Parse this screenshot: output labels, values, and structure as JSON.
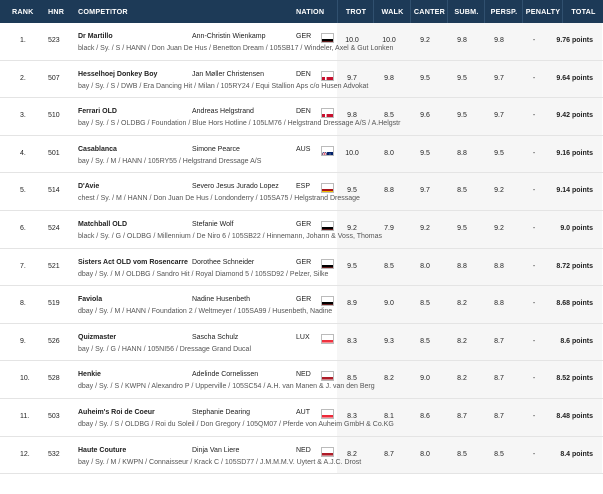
{
  "header": {
    "rank": "RANK",
    "hnr": "HNR",
    "competitor": "COMPETITOR",
    "nation": "NATION",
    "trot": "TROT",
    "walk": "WALK",
    "canter": "CANTER",
    "subm": "SUBM.",
    "persp": "PERSP.",
    "penalty": "PENALTY",
    "total": "TOTAL"
  },
  "rows": [
    {
      "rank": "1.",
      "hnr": "523",
      "horse": "Dr Martillo",
      "info": "black / Sy. / S / HANN / Don Juan De Hus / Benetton Dream / 105SB17 / Windeler, Axel & Gut Lonken",
      "rider": "Ann-Christin Wienkamp",
      "nation": "GER",
      "flag": "ger",
      "trot": "10.0",
      "walk": "10.0",
      "canter": "9.2",
      "subm": "9.8",
      "persp": "9.8",
      "penalty": "-",
      "total": "9.76 points"
    },
    {
      "rank": "2.",
      "hnr": "507",
      "horse": "Hesselhoej Donkey Boy",
      "info": "bay / Sy. / S / DWB / Era Dancing Hit / Milan / 105RY24 / Equi Stallion Aps c/o Husen Advokat",
      "rider": "Jan Møller Christensen",
      "nation": "DEN",
      "flag": "den",
      "trot": "9.7",
      "walk": "9.8",
      "canter": "9.5",
      "subm": "9.5",
      "persp": "9.7",
      "penalty": "-",
      "total": "9.64 points"
    },
    {
      "rank": "3.",
      "hnr": "510",
      "horse": "Ferrari OLD",
      "info": "bay / Sy. / S / OLDBG / Foundation / Blue Hors Hotline / 105LM76 / Helgstrand Dressage A/S / A.Helgstr",
      "rider": "Andreas Helgstrand",
      "nation": "DEN",
      "flag": "den",
      "trot": "9.8",
      "walk": "8.5",
      "canter": "9.6",
      "subm": "9.5",
      "persp": "9.7",
      "penalty": "-",
      "total": "9.42 points"
    },
    {
      "rank": "4.",
      "hnr": "501",
      "horse": "Casablanca",
      "info": "bay / Sy. / M / HANN / 105RY55 / Helgstrand Dressage A/S",
      "rider": "Simone Pearce",
      "nation": "AUS",
      "flag": "aus",
      "trot": "10.0",
      "walk": "8.0",
      "canter": "9.5",
      "subm": "8.8",
      "persp": "9.5",
      "penalty": "-",
      "total": "9.16 points"
    },
    {
      "rank": "5.",
      "hnr": "514",
      "horse": "D'Avie",
      "info": "chest / Sy. / M / HANN / Don Juan De Hus / Londonderry / 105SA75 / Helgstrand Dressage",
      "rider": "Severo Jesus Jurado Lopez",
      "nation": "ESP",
      "flag": "esp",
      "trot": "9.5",
      "walk": "8.8",
      "canter": "9.7",
      "subm": "8.5",
      "persp": "9.2",
      "penalty": "-",
      "total": "9.14 points"
    },
    {
      "rank": "6.",
      "hnr": "524",
      "horse": "Matchball OLD",
      "info": "black / Sy. / G / OLDBG / Millennium / De Niro 6 / 105SB22 / Hinnemann, Johann & Voss, Thomas",
      "rider": "Stefanie Wolf",
      "nation": "GER",
      "flag": "ger",
      "trot": "9.2",
      "walk": "7.9",
      "canter": "9.2",
      "subm": "9.5",
      "persp": "9.2",
      "penalty": "-",
      "total": "9.0 points"
    },
    {
      "rank": "7.",
      "hnr": "521",
      "horse": "Sisters Act OLD vom Rosencarre",
      "info": "dbay / Sy. / M / OLDBG / Sandro Hit / Royal Diamond 5 / 105SD92 / Pelzer, Silke",
      "rider": "Dorothee Schneider",
      "nation": "GER",
      "flag": "ger",
      "trot": "9.5",
      "walk": "8.5",
      "canter": "8.0",
      "subm": "8.8",
      "persp": "8.8",
      "penalty": "-",
      "total": "8.72 points"
    },
    {
      "rank": "8.",
      "hnr": "519",
      "horse": "Faviola",
      "info": "dbay / Sy. / M / HANN / Foundation 2 / Weltmeyer / 105SA99 / Husenbeth, Nadine",
      "rider": "Nadine Husenbeth",
      "nation": "GER",
      "flag": "ger",
      "trot": "8.9",
      "walk": "9.0",
      "canter": "8.5",
      "subm": "8.2",
      "persp": "8.8",
      "penalty": "-",
      "total": "8.68 points"
    },
    {
      "rank": "9.",
      "hnr": "526",
      "horse": "Quizmaster",
      "info": "bay / Sy. / G / HANN / 105NI56 / Dressage Grand Ducal",
      "rider": "Sascha Schulz",
      "nation": "LUX",
      "flag": "lux",
      "trot": "8.3",
      "walk": "9.3",
      "canter": "8.5",
      "subm": "8.2",
      "persp": "8.7",
      "penalty": "-",
      "total": "8.6 points"
    },
    {
      "rank": "10.",
      "hnr": "528",
      "horse": "Henkie",
      "info": "dbay / Sy. / S / KWPN / Alexandro P / Upperville / 105SC54 / A.H. van Manen & J. van den Berg",
      "rider": "Adelinde Cornelissen",
      "nation": "NED",
      "flag": "ned",
      "trot": "8.5",
      "walk": "8.2",
      "canter": "9.0",
      "subm": "8.2",
      "persp": "8.7",
      "penalty": "-",
      "total": "8.52 points"
    },
    {
      "rank": "11.",
      "hnr": "503",
      "horse": "Auheim's Roi de Coeur",
      "info": "dbay / Sy. / S / OLDBG / Roi du Soleil / Don Gregory / 105QM07 / Pferde von Auheim GmbH & Co.KG",
      "rider": "Stephanie Dearing",
      "nation": "AUT",
      "flag": "aut",
      "trot": "8.3",
      "walk": "8.1",
      "canter": "8.6",
      "subm": "8.7",
      "persp": "8.7",
      "penalty": "-",
      "total": "8.48 points"
    },
    {
      "rank": "12.",
      "hnr": "532",
      "horse": "Haute Couture",
      "info": "bay / Sy. / M / KWPN / Connaisseur / Krack C / 105SD77 / J.M.M.M.V. Uytert & A.J.C. Drost",
      "rider": "Dinja Van Liere",
      "nation": "NED",
      "flag": "ned",
      "trot": "8.2",
      "walk": "8.7",
      "canter": "8.0",
      "subm": "8.5",
      "persp": "8.5",
      "penalty": "-",
      "total": "8.4 points"
    }
  ]
}
